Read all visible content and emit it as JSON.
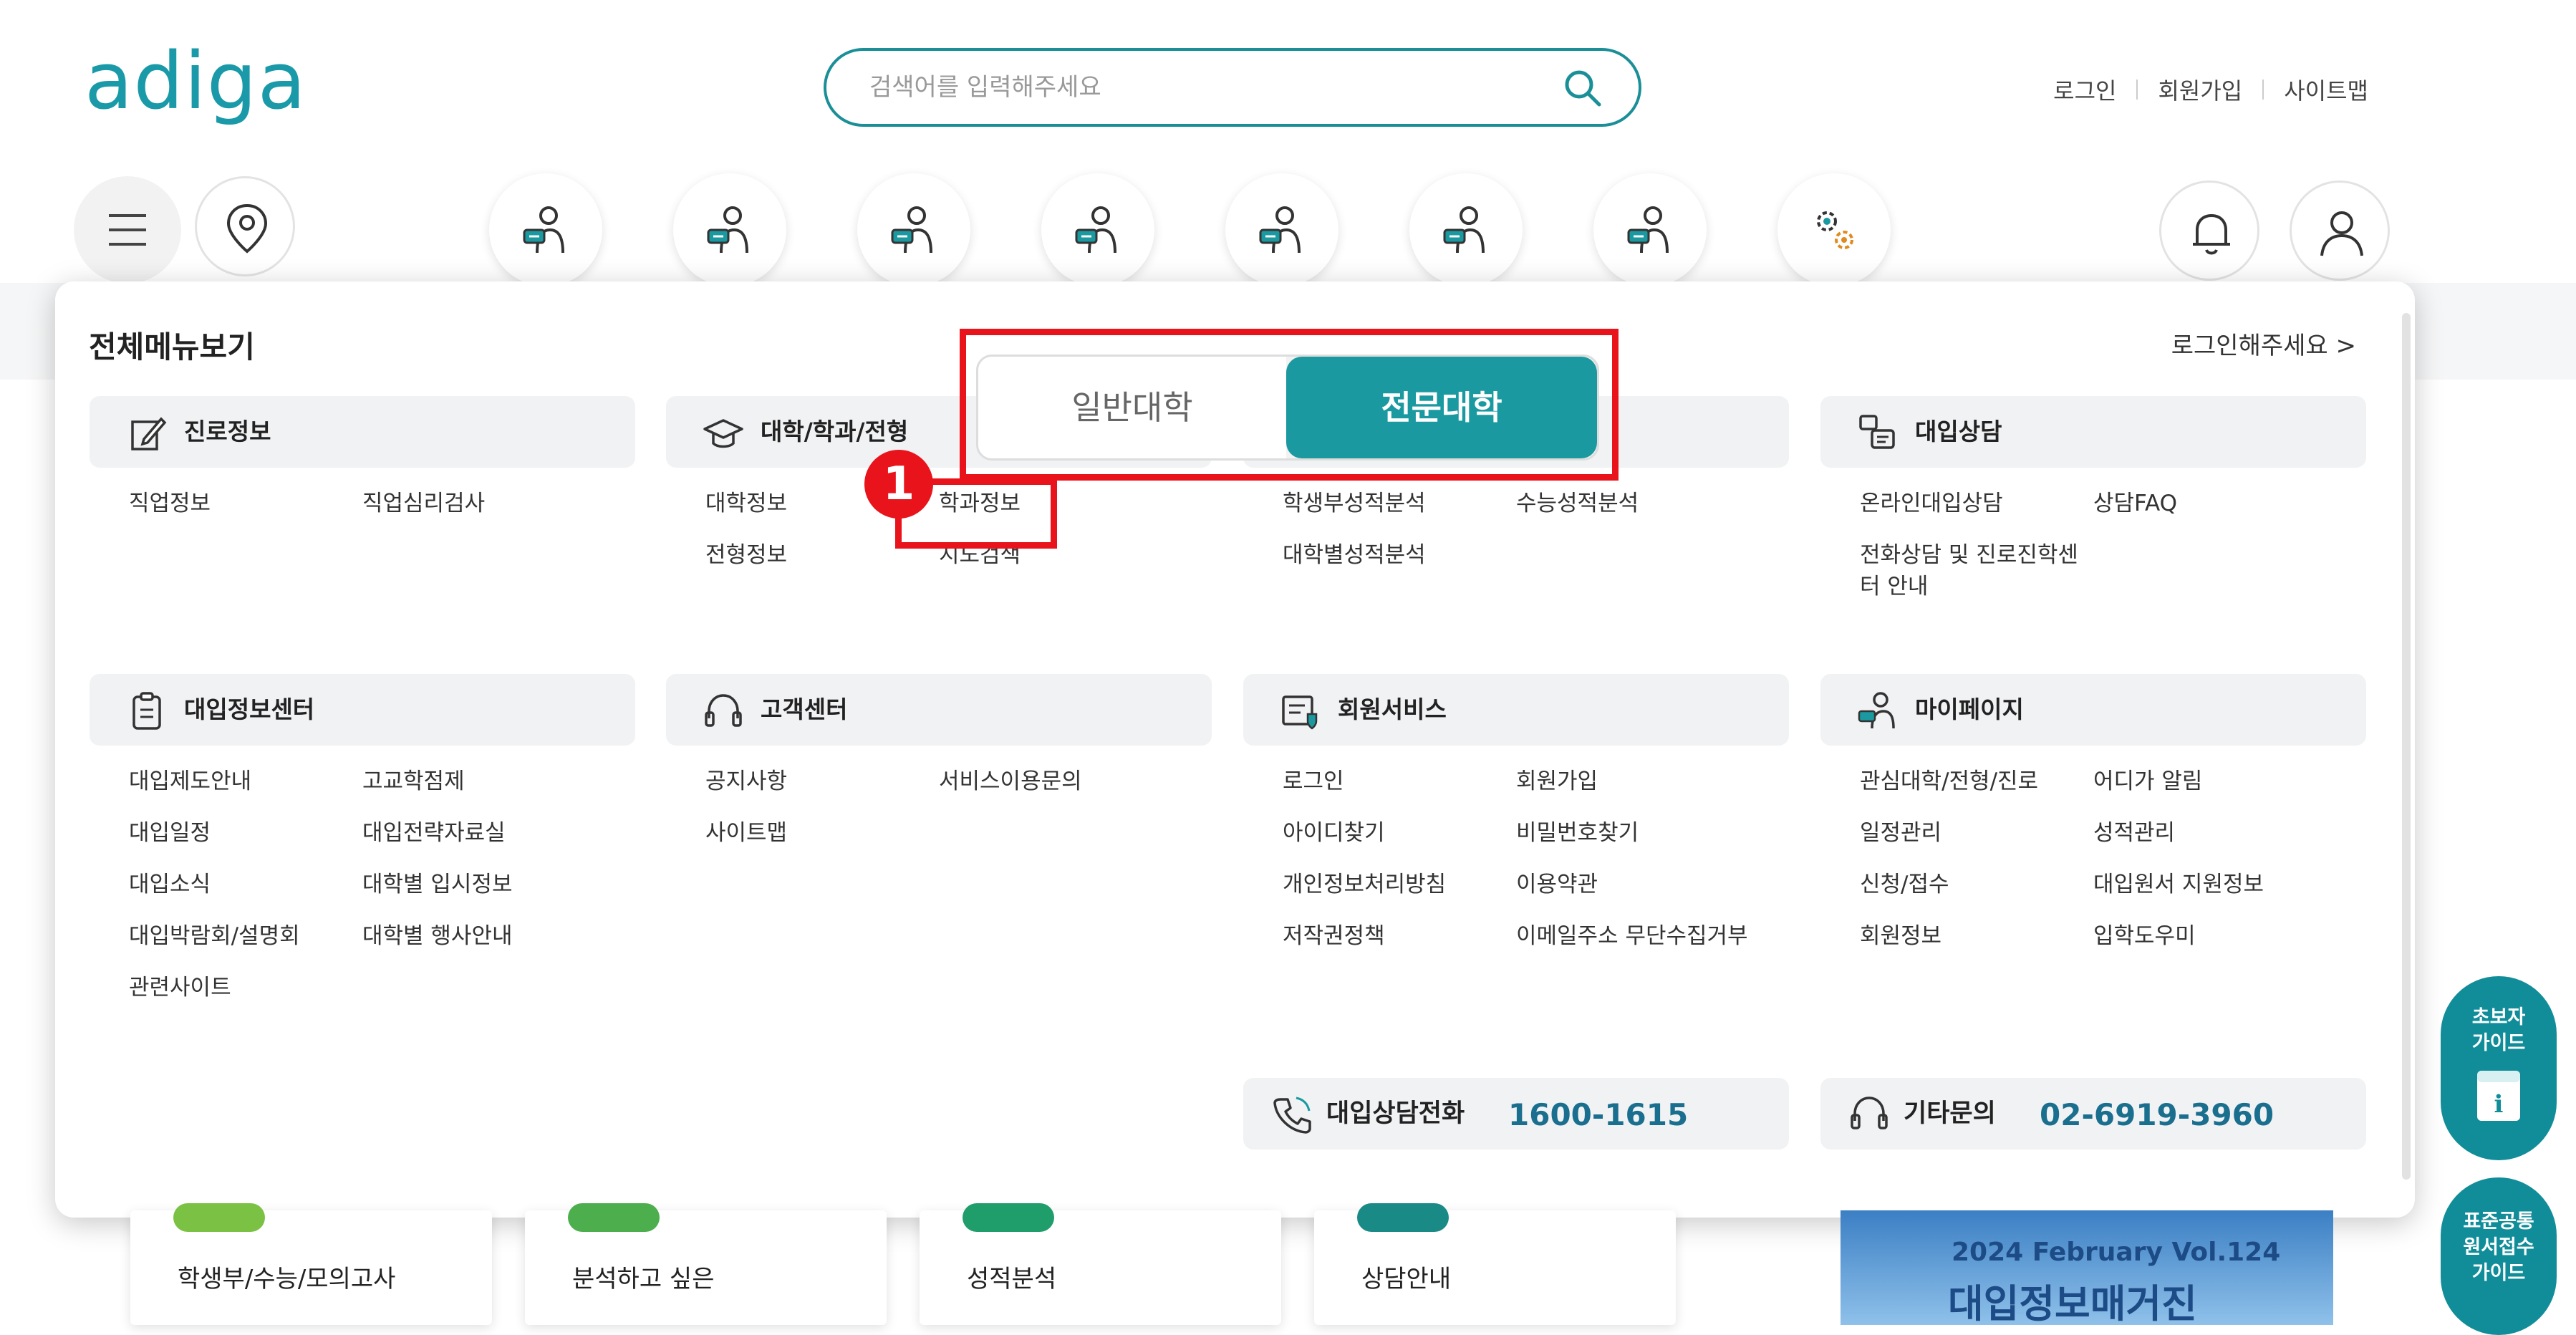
{
  "header": {
    "logo": "adiga",
    "search_placeholder": "검색어를 입력해주세요",
    "links": [
      "로그인",
      "회원가입",
      "사이트맵"
    ]
  },
  "toolbar": {
    "menu_icon": "hamburger-icon",
    "location_icon": "map-pin-icon",
    "category_icons": [
      "person-chat-icon",
      "person-chat-icon",
      "person-chat-icon",
      "person-chat-icon",
      "person-chat-icon",
      "person-chat-icon",
      "person-chat-icon",
      "gears-icon"
    ],
    "right_icons": [
      "bell-icon",
      "user-icon"
    ]
  },
  "panel": {
    "title": "전체메뉴보기",
    "login_prompt": "로그인해주세요 >",
    "sections": [
      {
        "title": "진로정보",
        "icon": "edit-icon",
        "items": [
          "직업정보",
          "직업심리검사"
        ]
      },
      {
        "title": "대학/학과/전형",
        "icon": "graduation-cap-icon",
        "items": [
          "대학정보",
          "학과정보",
          "전형정보",
          "지도검색"
        ]
      },
      {
        "title": "",
        "icon": "",
        "items": [
          "학생부성적분석",
          "수능성적분석",
          "대학별성적분석"
        ]
      },
      {
        "title": "대입상담",
        "icon": "chat-icon",
        "items": [
          "온라인대입상담",
          "상담FAQ",
          "전화상담 및 진로진학센터 안내"
        ]
      },
      {
        "title": "대입정보센터",
        "icon": "clipboard-icon",
        "items": [
          "대입제도안내",
          "고교학점제",
          "대입일정",
          "대입전략자료실",
          "대입소식",
          "대학별 입시정보",
          "대입박람회/설명회",
          "대학별 행사안내",
          "관련사이트"
        ]
      },
      {
        "title": "고객센터",
        "icon": "headset-icon",
        "items": [
          "공지사항",
          "서비스이용문의",
          "사이트맵"
        ]
      },
      {
        "title": "회원서비스",
        "icon": "member-card-icon",
        "items": [
          "로그인",
          "회원가입",
          "아이디찾기",
          "비밀번호찾기",
          "개인정보처리방침",
          "이용약관",
          "저작권정책",
          "이메일주소 무단수집거부"
        ]
      },
      {
        "title": "마이페이지",
        "icon": "person-chat-icon",
        "items": [
          "관심대학/전형/진로",
          "어디가 알림",
          "일정관리",
          "성적관리",
          "신청/접수",
          "대입원서 지원정보",
          "회원정보",
          "입학도우미"
        ]
      }
    ],
    "contacts": [
      {
        "label": "대입상담전화",
        "number": "1600-1615",
        "icon": "phone-icon"
      },
      {
        "label": "기타문의",
        "number": "02-6919-3960",
        "icon": "headset-icon"
      }
    ]
  },
  "overlay": {
    "toggle": [
      "일반대학",
      "전문대학"
    ],
    "badge": "1"
  },
  "bottom": {
    "cards": [
      "학생부/수능/모의고사",
      "분석하고 싶은",
      "성적분석",
      "상담안내"
    ],
    "magazine_issue": "2024 February Vol.124",
    "magazine_title": "대입정보매거진"
  },
  "side_buttons": [
    "초보자\n가이드",
    "표준공통\n원서접수\n가이드"
  ],
  "colors": {
    "brand": "#1a9aa0",
    "accent_red": "#e8131b",
    "contact_number": "#1a6e8e"
  }
}
